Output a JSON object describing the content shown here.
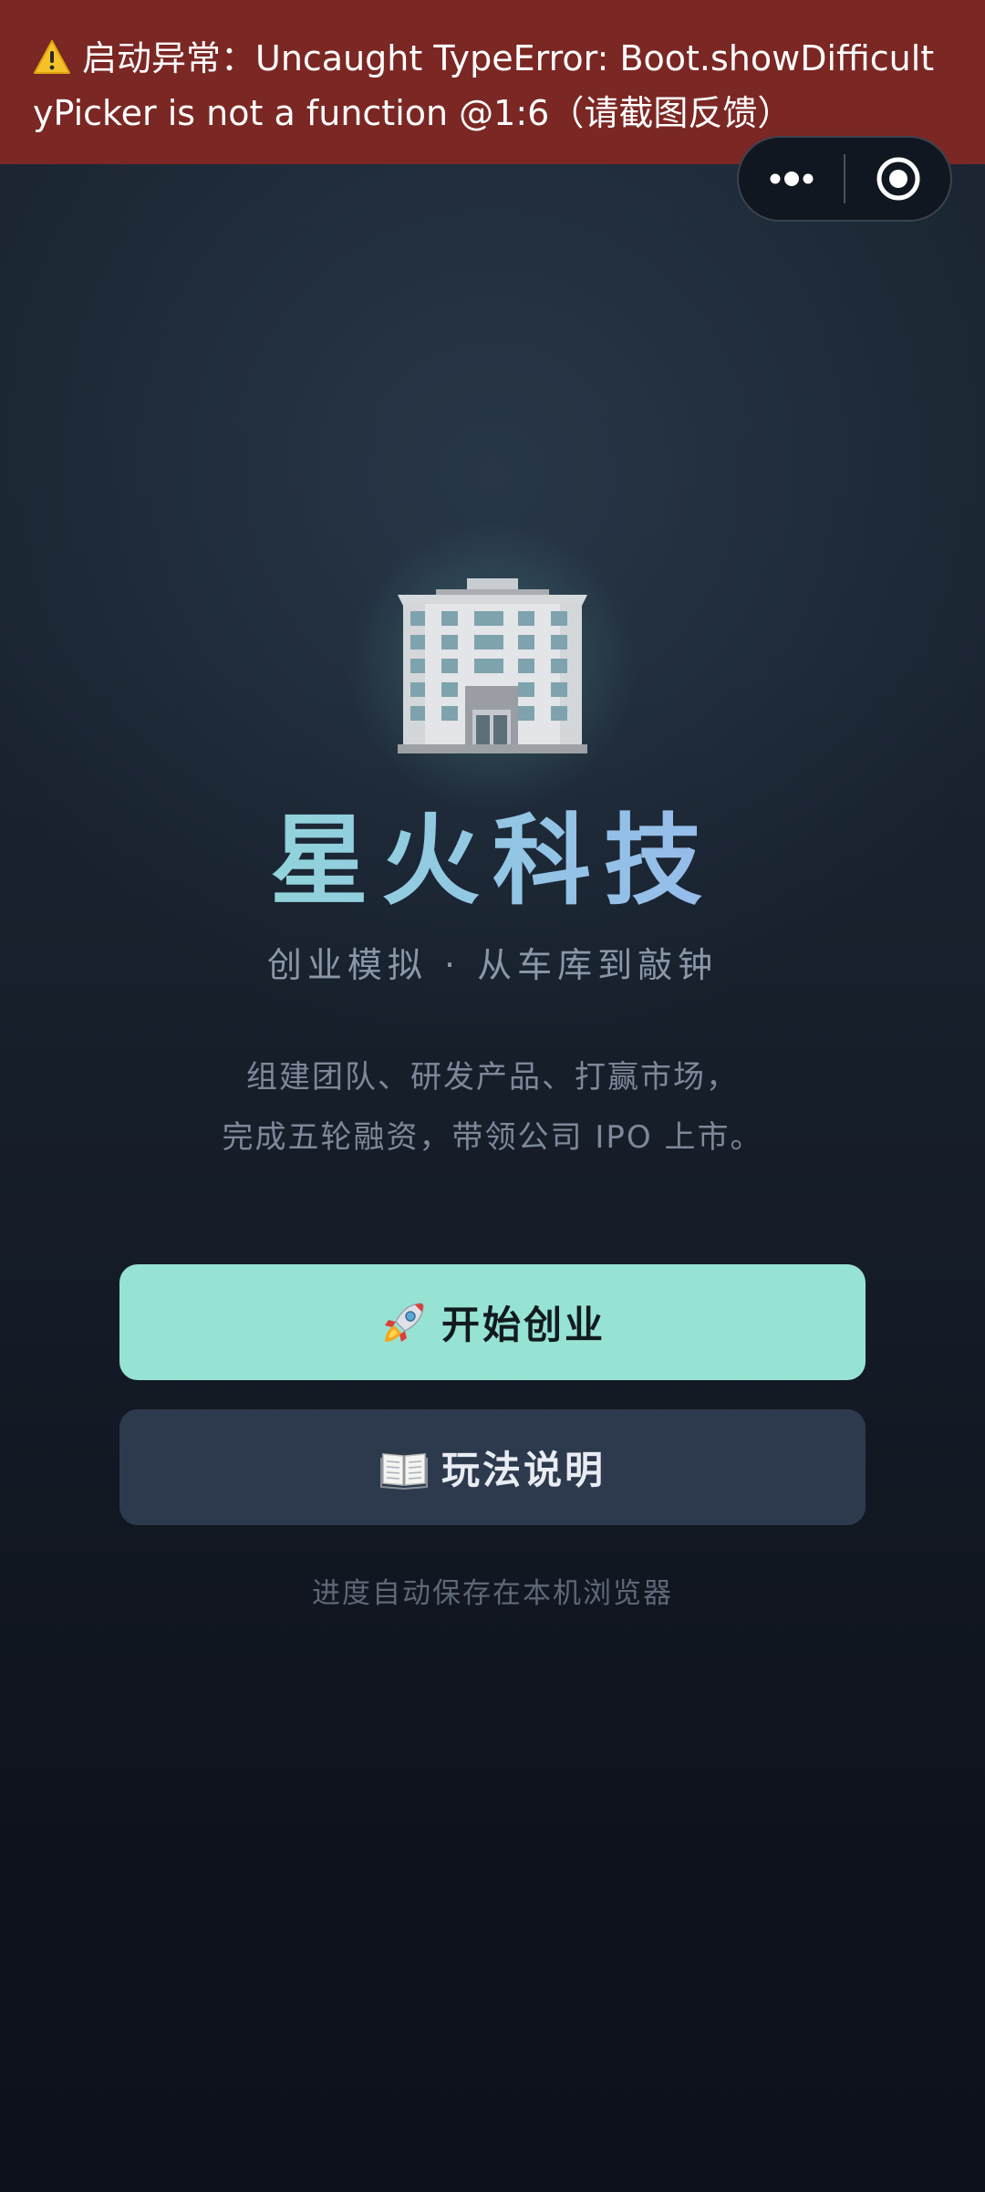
{
  "error_banner": {
    "icon": "warning-icon",
    "text": "启动异常：Uncaught TypeError: Boot.showDifficultyPicker is not a function @1:6（请截图反馈）",
    "background": "#7b2723"
  },
  "capsule": {
    "more_icon": "more-dots-icon",
    "close_icon": "close-target-icon"
  },
  "app": {
    "logo_icon": "office-building-icon",
    "title": "星火科技",
    "subtitle": "创业模拟 · 从车库到敲钟",
    "description_line1": "组建团队、研发产品、打赢市场，",
    "description_line2": "完成五轮融资，带领公司 IPO 上市。"
  },
  "buttons": {
    "start": {
      "icon": "rocket-icon",
      "label": "开始创业",
      "color": "#96e3d3"
    },
    "help": {
      "icon": "open-book-icon",
      "label": "玩法说明",
      "color": "#2d3a4e"
    }
  },
  "footer": {
    "note": "进度自动保存在本机浏览器"
  },
  "colors": {
    "accent": "#96e3d3",
    "title_gradient_start": "#8fe3cf",
    "title_gradient_end": "#9aaef2"
  }
}
